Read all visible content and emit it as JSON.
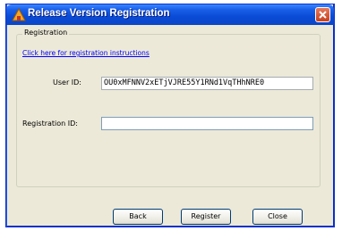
{
  "window": {
    "title": "Release Version Registration"
  },
  "registration": {
    "group_label": "Registration",
    "link_text": "Click here for registration instructions",
    "user_id_label": "User ID:",
    "user_id_value": "OU0xMFNNV2xETjVJRE55Y1RNd1VqTHhNRE0",
    "registration_id_label": "Registration ID:",
    "registration_id_value": ""
  },
  "buttons": {
    "back": "Back",
    "register": "Register",
    "close": "Close"
  }
}
